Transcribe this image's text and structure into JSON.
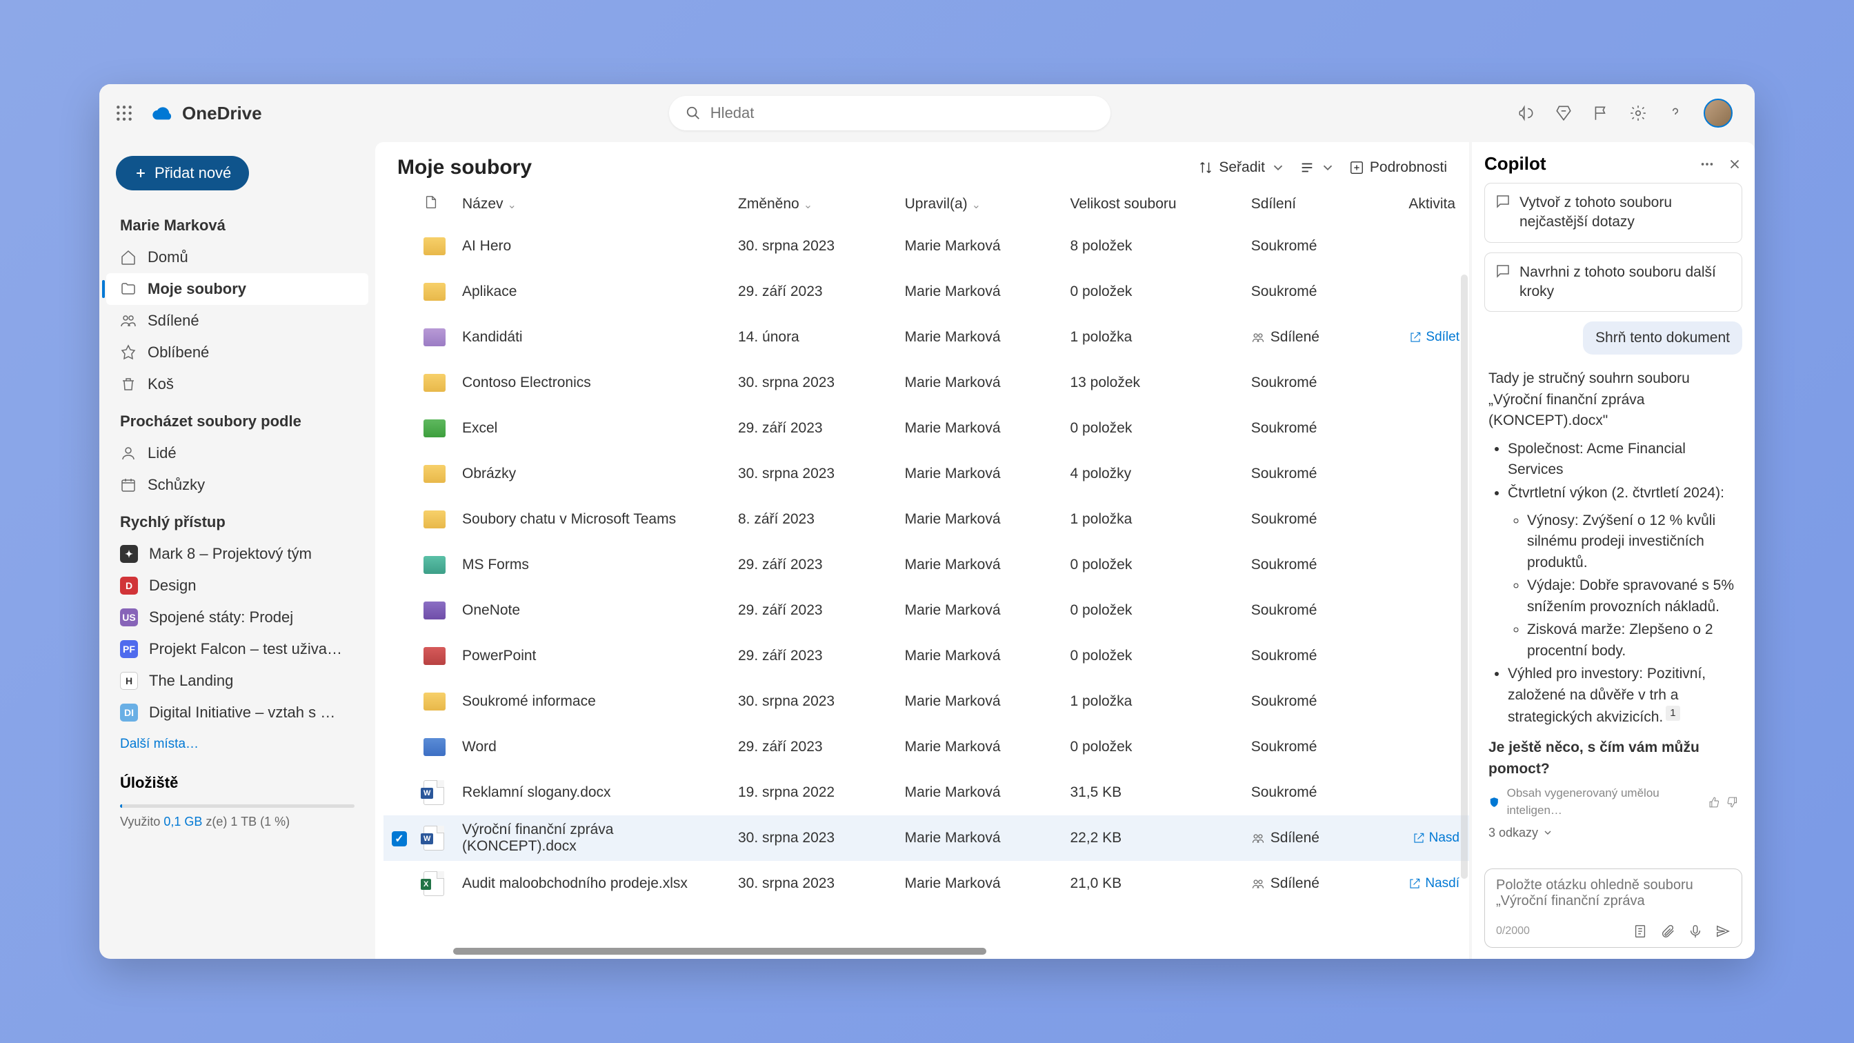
{
  "brand": "OneDrive",
  "search": {
    "placeholder": "Hledat"
  },
  "sidebar": {
    "add": "Přidat nové",
    "user": "Marie Marková",
    "nav": [
      {
        "label": "Domů"
      },
      {
        "label": "Moje soubory"
      },
      {
        "label": "Sdílené"
      },
      {
        "label": "Oblíbené"
      },
      {
        "label": "Koš"
      }
    ],
    "browse_h": "Procházet soubory podle",
    "browse": [
      {
        "label": "Lidé"
      },
      {
        "label": "Schůzky"
      }
    ],
    "quick_h": "Rychlý přístup",
    "quick": [
      {
        "label": "Mark 8 – Projektový tým",
        "box": "dark",
        "ini": "✦"
      },
      {
        "label": "Design",
        "box": "red",
        "ini": "D"
      },
      {
        "label": "Spojené státy: Prodej",
        "box": "purple",
        "ini": "US"
      },
      {
        "label": "Projekt Falcon – test uživa…",
        "box": "blue",
        "ini": "PF"
      },
      {
        "label": "The Landing",
        "box": "white",
        "ini": "H"
      },
      {
        "label": "Digital Initiative – vztah s …",
        "box": "lblue",
        "ini": "DI"
      }
    ],
    "more": "Další místa…",
    "storage": {
      "h": "Úložiště",
      "used": "0,1 GB",
      "pre": "Využito ",
      "post": " z(e) 1 TB (1 %)"
    }
  },
  "page": {
    "title": "Moje soubory",
    "sort": "Seřadit",
    "details": "Podrobnosti"
  },
  "columns": {
    "name": "Název",
    "modified": "Změněno",
    "modifiedby": "Upravil(a)",
    "size": "Velikost souboru",
    "sharing": "Sdílení",
    "activity": "Aktivita"
  },
  "rows": [
    {
      "type": "folder",
      "color": "yellow",
      "name": "AI Hero",
      "modified": "30. srpna 2023",
      "by": "Marie Marková",
      "size": "8 položek",
      "share": "Soukromé"
    },
    {
      "type": "folder",
      "color": "yellow",
      "name": "Aplikace",
      "modified": "29. září 2023",
      "by": "Marie Marková",
      "size": "0 položek",
      "share": "Soukromé"
    },
    {
      "type": "folder",
      "color": "purple",
      "name": "Kandidáti",
      "modified": "14. února",
      "by": "Marie Marková",
      "size": "1 položka",
      "share": "Sdílené",
      "shared": true,
      "activity": "Sdílet"
    },
    {
      "type": "folder",
      "color": "yellow",
      "name": "Contoso Electronics",
      "modified": "30. srpna 2023",
      "by": "Marie Marková",
      "size": "13 položek",
      "share": "Soukromé"
    },
    {
      "type": "folder",
      "color": "green",
      "name": "Excel",
      "modified": "29. září 2023",
      "by": "Marie Marková",
      "size": "0 položek",
      "share": "Soukromé"
    },
    {
      "type": "folder",
      "color": "yellow",
      "name": "Obrázky",
      "modified": "30. srpna 2023",
      "by": "Marie Marková",
      "size": "4 položky",
      "share": "Soukromé"
    },
    {
      "type": "folder",
      "color": "yellow",
      "name": "Soubory chatu v Microsoft Teams",
      "modified": "8. září 2023",
      "by": "Marie Marková",
      "size": "1 položka",
      "share": "Soukromé"
    },
    {
      "type": "folder",
      "color": "teal",
      "name": "MS Forms",
      "modified": "29. září 2023",
      "by": "Marie Marková",
      "size": "0 položek",
      "share": "Soukromé"
    },
    {
      "type": "folder",
      "color": "dpurple",
      "name": "OneNote",
      "modified": "29. září 2023",
      "by": "Marie Marková",
      "size": "0 položek",
      "share": "Soukromé"
    },
    {
      "type": "folder",
      "color": "red",
      "name": "PowerPoint",
      "modified": "29. září 2023",
      "by": "Marie Marková",
      "size": "0 položek",
      "share": "Soukromé"
    },
    {
      "type": "folder",
      "color": "yellow",
      "name": "Soukromé informace",
      "modified": "30. srpna 2023",
      "by": "Marie Marková",
      "size": "1 položka",
      "share": "Soukromé"
    },
    {
      "type": "folder",
      "color": "blue",
      "name": "Word",
      "modified": "29. září 2023",
      "by": "Marie Marková",
      "size": "0 položek",
      "share": "Soukromé"
    },
    {
      "type": "word",
      "name": "Reklamní slogany.docx",
      "modified": "19. srpna 2022",
      "by": "Marie Marková",
      "size": "31,5 KB",
      "share": "Soukromé"
    },
    {
      "type": "word",
      "name": "Výroční finanční zpráva (KONCEPT).docx",
      "modified": "30. srpna 2023",
      "by": "Marie Marková",
      "size": "22,2 KB",
      "share": "Sdílené",
      "shared": true,
      "selected": true,
      "activity": "Nasd"
    },
    {
      "type": "excel",
      "name": "Audit maloobchodního prodeje.xlsx",
      "modified": "30. srpna 2023",
      "by": "Marie Marková",
      "size": "21,0 KB",
      "share": "Sdílené",
      "shared": true,
      "activity": "Nasdí"
    }
  ],
  "copilot": {
    "title": "Copilot",
    "suggestions": [
      "Vytvoř z tohoto souboru nejčastější dotazy",
      "Navrhni z tohoto souboru další kroky"
    ],
    "user_msg": "Shrň tento dokument",
    "response": {
      "intro": "Tady je stručný souhrn souboru „Výroční finanční zpráva (KONCEPT).docx\"",
      "b1": "Společnost: Acme Financial Services",
      "b2": "Čtvrtletní výkon (2. čtvrtletí 2024):",
      "s1": "Výnosy: Zvýšení o 12 % kvůli silnému prodeji investičních produktů.",
      "s2": "Výdaje: Dobře spravované s 5% snížením provozních nákladů.",
      "s3": "Zisková marže: Zlepšeno o 2 procentní body.",
      "b3": "Výhled pro investory: Pozitivní, založené na důvěře v trh a strategických akvizicích.",
      "outro": "Je ještě něco, s čím vám můžu pomoct?"
    },
    "ai_note": "Obsah vygenerovaný umělou inteligen…",
    "refs": "3 odkazy",
    "input_placeholder": "Položte otázku ohledně souboru „Výroční finanční zpráva",
    "counter": "0/2000"
  }
}
